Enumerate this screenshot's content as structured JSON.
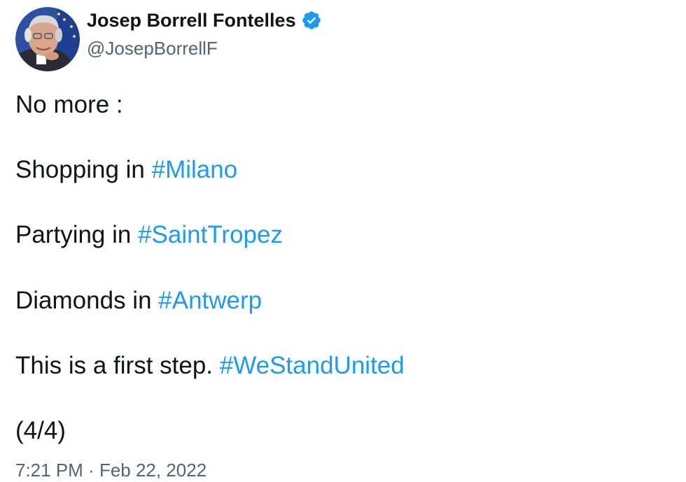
{
  "author": {
    "display_name": "Josep Borrell Fontelles",
    "handle": "@JosepBorrellF",
    "verified": true,
    "avatar_icon": "profile-photo",
    "verified_icon": "verified-badge-icon"
  },
  "tweet": {
    "lines": [
      {
        "text": "No more :",
        "hashtag": ""
      },
      {
        "text": "Shopping in ",
        "hashtag": "#Milano"
      },
      {
        "text": "Partying in ",
        "hashtag": "#SaintTropez"
      },
      {
        "text": "Diamonds in ",
        "hashtag": "#Antwerp"
      },
      {
        "text": "This is a first step. ",
        "hashtag": "#WeStandUnited"
      },
      {
        "text": "(4/4)",
        "hashtag": ""
      }
    ],
    "time": "7:21 PM",
    "separator": " · ",
    "date": "Feb 22, 2022"
  },
  "colors": {
    "text": "#0f1419",
    "secondary": "#536471",
    "link": "#1d9bf0",
    "verified": "#1d9bf0",
    "background": "#ffffff"
  }
}
